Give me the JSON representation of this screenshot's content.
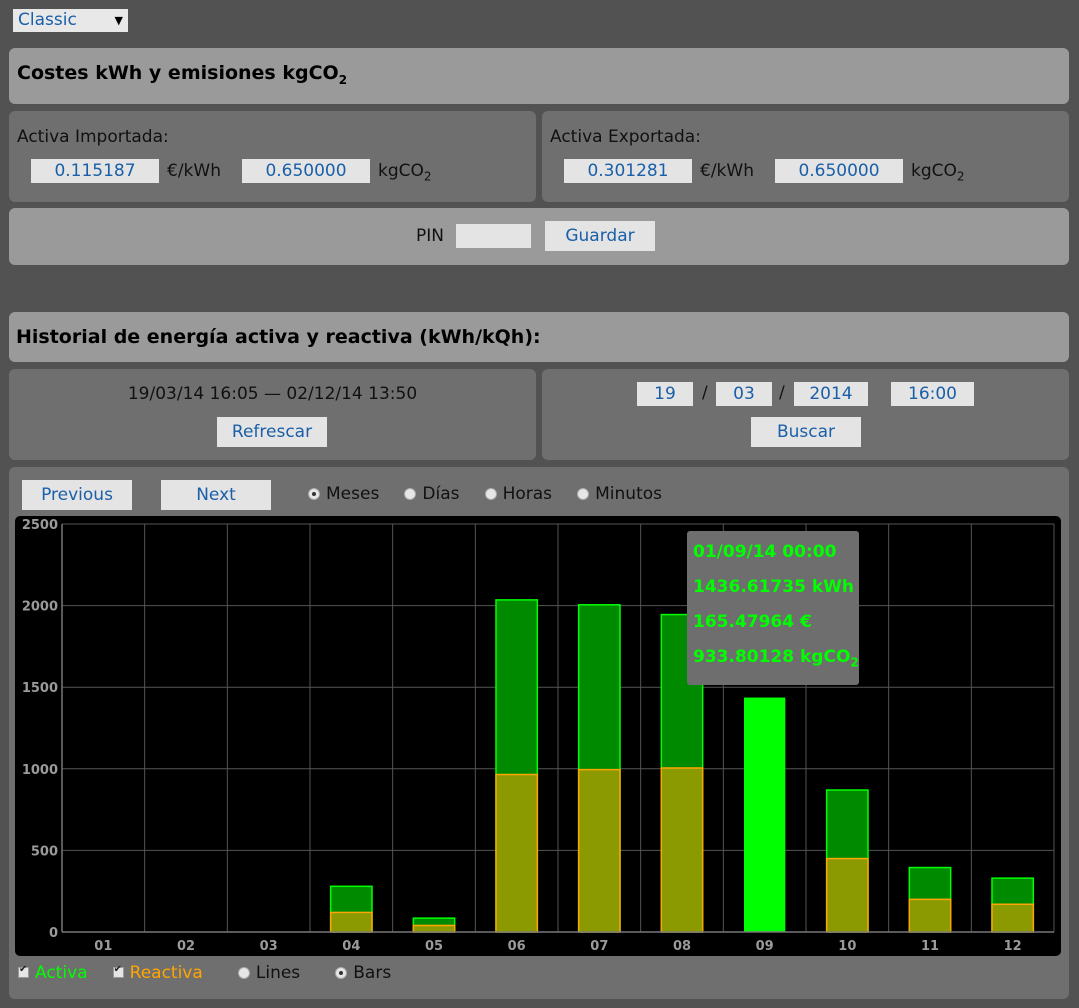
{
  "theme_select": {
    "value": "Classic"
  },
  "costs": {
    "title": "Costes kWh y emisiones kgCO",
    "title_sub": "2",
    "imported": {
      "label": "Activa Importada:",
      "price": "0.115187",
      "price_unit": "€/kWh",
      "co2": "0.650000",
      "co2_unit": "kgCO",
      "co2_unit_sub": "2"
    },
    "exported": {
      "label": "Activa Exportada:",
      "price": "0.301281",
      "price_unit": "€/kWh",
      "co2": "0.650000",
      "co2_unit": "kgCO",
      "co2_unit_sub": "2"
    },
    "pin_label": "PIN",
    "pin_value": "",
    "save_label": "Guardar"
  },
  "history": {
    "title": "Historial de energía activa y reactiva (kWh/kQh):",
    "range": "19/03/14 16:05 — 02/12/14 13:50",
    "refresh_label": "Refrescar",
    "date": {
      "day": "19",
      "month": "03",
      "year": "2014",
      "time": "16:00",
      "sep": "/"
    },
    "search_label": "Buscar"
  },
  "nav": {
    "previous_label": "Previous",
    "next_label": "Next"
  },
  "granularity": {
    "options": [
      "Meses",
      "Días",
      "Horas",
      "Minutos"
    ],
    "selected": "Meses"
  },
  "legend": {
    "activa_label": "Activa",
    "reactiva_label": "Reactiva",
    "activa_color": "#00ff00",
    "reactiva_color": "#ffa500",
    "lines_label": "Lines",
    "bars_label": "Bars",
    "mode": "Bars"
  },
  "tooltip": {
    "date": "01/09/14 00:00",
    "kwh": "1436.61735 kWh",
    "eur": "165.47964 €",
    "co2": "933.80128 kgCO",
    "co2_sub": "2"
  },
  "chart_data": {
    "type": "bar",
    "categories": [
      "01",
      "02",
      "03",
      "04",
      "05",
      "06",
      "07",
      "08",
      "09",
      "10",
      "11",
      "12"
    ],
    "series": [
      {
        "name": "Activa",
        "values": [
          0,
          0,
          0,
          280,
          85,
          2035,
          2005,
          1945,
          1436.61735,
          870,
          395,
          330
        ]
      },
      {
        "name": "Reactiva",
        "values": [
          0,
          0,
          0,
          120,
          40,
          965,
          995,
          1005,
          0,
          450,
          200,
          170
        ]
      }
    ],
    "highlighted_category": "09",
    "ylim": [
      0,
      2500
    ],
    "yticks": [
      0,
      500,
      1000,
      1500,
      2000,
      2500
    ],
    "grid": true,
    "colors": {
      "background": "#000000",
      "grid": "#555555",
      "activa": "#00ff00",
      "reactiva": "#ffa500",
      "axis_text": "#9a9a9a"
    }
  }
}
